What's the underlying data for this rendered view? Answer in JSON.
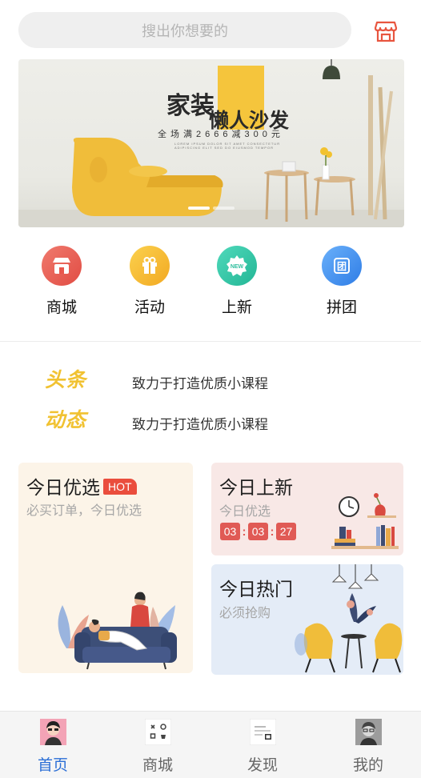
{
  "search": {
    "placeholder": "搜出你想要的"
  },
  "header": {
    "store_icon": "store-icon",
    "accent": "#e8553f"
  },
  "banner": {
    "title_1": "家装",
    "title_2": "懒人沙发",
    "promo": "全场满2666减300元",
    "fine_print": "LOREM IPSUM DOLOR SIT AMET CONSECTETUR ADIPISCING ELIT SED DO EIUSMOD TEMPOR",
    "slide_count": 2,
    "active_slide": 1
  },
  "categories": [
    {
      "label": "商城",
      "icon": "shop-icon",
      "color": "#ea5b50"
    },
    {
      "label": "活动",
      "icon": "gift-icon",
      "color": "#f6b830"
    },
    {
      "label": "上新",
      "icon": "new-icon",
      "color": "#36c9a8"
    },
    {
      "label": "拼团",
      "icon": "group-icon",
      "color": "#3e8ff0"
    }
  ],
  "news": {
    "logo_1": "头条",
    "logo_2": "动态",
    "items": [
      "致力于打造优质小课程",
      "致力于打造优质小课程"
    ]
  },
  "cards": {
    "pick": {
      "title": "今日优选",
      "badge": "HOT",
      "subtitle": "必买订单，今日优选"
    },
    "new": {
      "title": "今日上新",
      "subtitle": "今日优选",
      "countdown": [
        "03",
        "03",
        "27"
      ]
    },
    "hot": {
      "title": "今日热门",
      "subtitle": "必须抢购"
    }
  },
  "tabs": [
    {
      "label": "首页",
      "icon": "home-avatar-icon",
      "active": true
    },
    {
      "label": "商城",
      "icon": "grid-icon",
      "active": false
    },
    {
      "label": "发现",
      "icon": "discover-icon",
      "active": false
    },
    {
      "label": "我的",
      "icon": "profile-avatar-icon",
      "active": false
    }
  ],
  "colors": {
    "active_tab": "#2b6fd6",
    "news_logo": "#f1c232",
    "countdown": "#e05a55"
  }
}
